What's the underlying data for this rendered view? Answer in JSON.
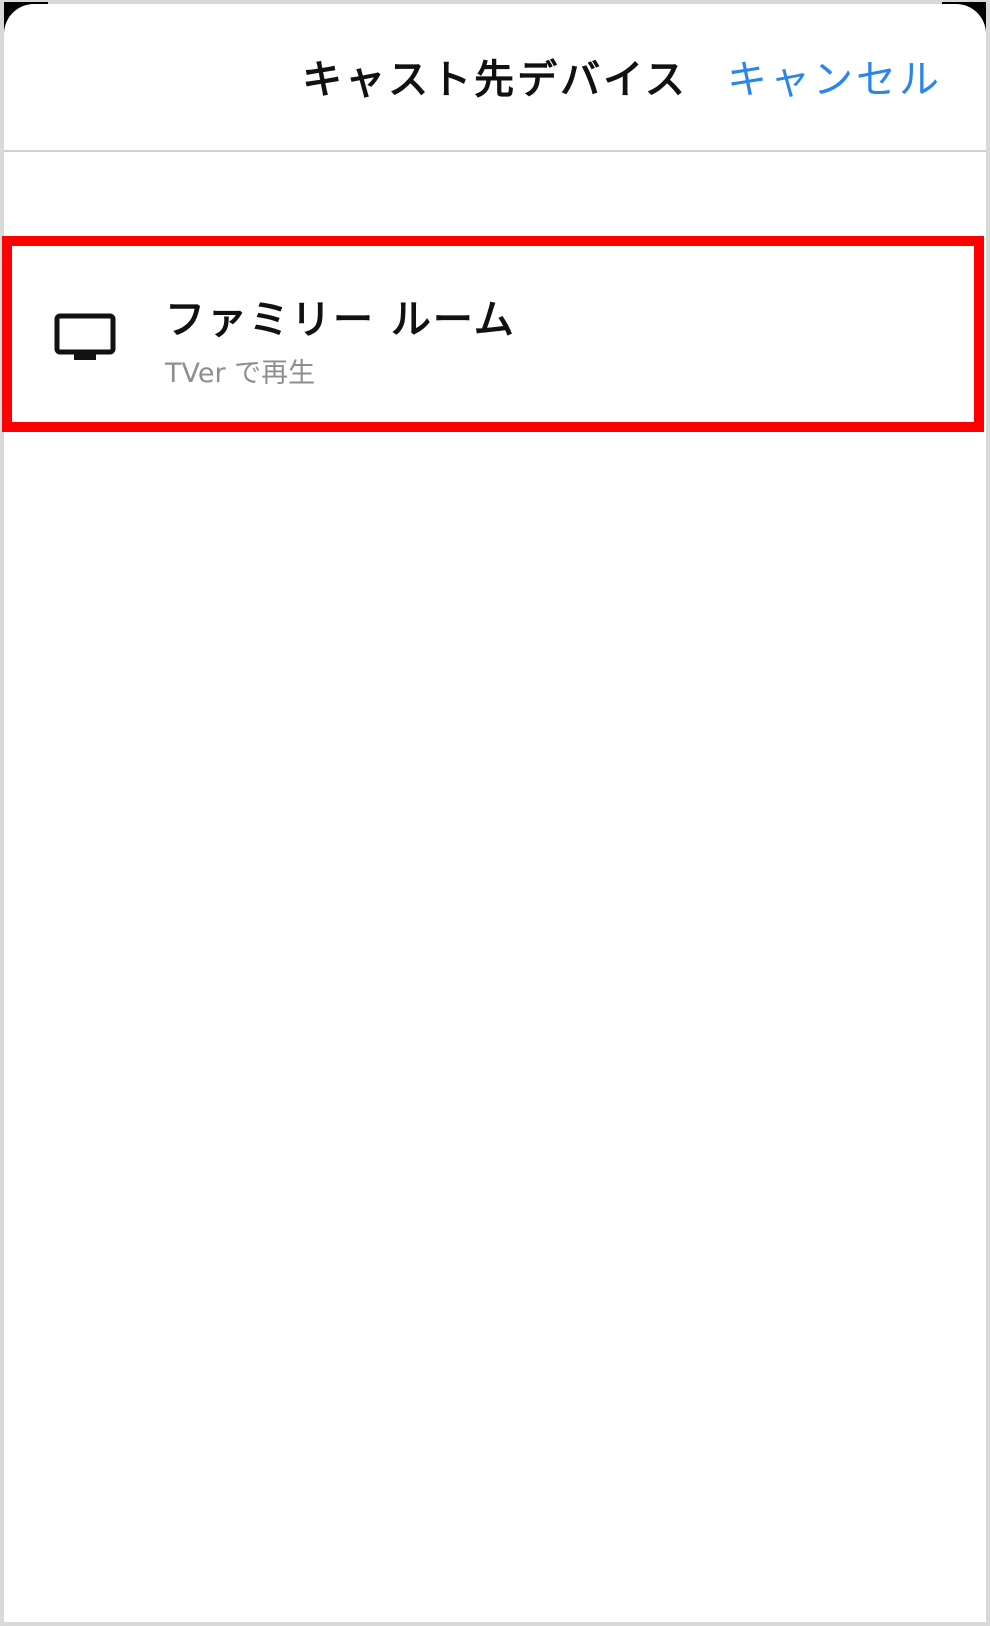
{
  "header": {
    "title": "キャスト先デバイス",
    "cancel_label": "キャンセル"
  },
  "devices": [
    {
      "icon": "tv-icon",
      "name": "ファミリー ルーム",
      "subtitle": "TVer で再生"
    }
  ],
  "colors": {
    "accent": "#2a86e8",
    "highlight": "#ff0000",
    "subtext": "#8e8e8e",
    "divider": "#cfcfcf"
  }
}
